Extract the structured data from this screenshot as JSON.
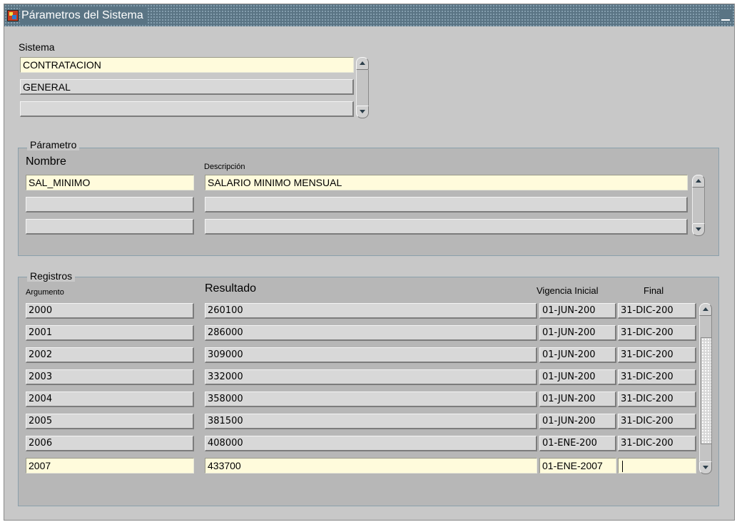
{
  "window": {
    "title": "Párametros del Sistema"
  },
  "sistema": {
    "label": "Sistema",
    "rows": [
      "CONTRATACION",
      "GENERAL",
      ""
    ]
  },
  "parametro": {
    "group_title": "Párametro",
    "nombre_label": "Nombre",
    "descripcion_label": "Descripción",
    "rows": [
      {
        "nombre": "SAL_MINIMO",
        "descripcion": "SALARIO MINIMO MENSUAL"
      },
      {
        "nombre": "",
        "descripcion": ""
      },
      {
        "nombre": "",
        "descripcion": ""
      }
    ]
  },
  "registros": {
    "group_title": "Registros",
    "headers": {
      "argumento": "Argumento",
      "resultado": "Resultado",
      "vigencia_inicial": "Vigencia Inicial",
      "final": "Final"
    },
    "rows": [
      {
        "argumento": "2000",
        "resultado": "260100",
        "inicial": "01-JUN-200",
        "final": "31-DIC-200"
      },
      {
        "argumento": "2001",
        "resultado": "286000",
        "inicial": "01-JUN-200",
        "final": "31-DIC-200"
      },
      {
        "argumento": "2002",
        "resultado": "309000",
        "inicial": "01-JUN-200",
        "final": "31-DIC-200"
      },
      {
        "argumento": "2003",
        "resultado": "332000",
        "inicial": "01-JUN-200",
        "final": "31-DIC-200"
      },
      {
        "argumento": "2004",
        "resultado": "358000",
        "inicial": "01-JUN-200",
        "final": "31-DIC-200"
      },
      {
        "argumento": "2005",
        "resultado": "381500",
        "inicial": "01-JUN-200",
        "final": "31-DIC-200"
      },
      {
        "argumento": "2006",
        "resultado": "408000",
        "inicial": "01-ENE-200",
        "final": "31-DIC-200"
      },
      {
        "argumento": "2007",
        "resultado": "433700",
        "inicial": "01-ENE-2007",
        "final": ""
      }
    ]
  }
}
